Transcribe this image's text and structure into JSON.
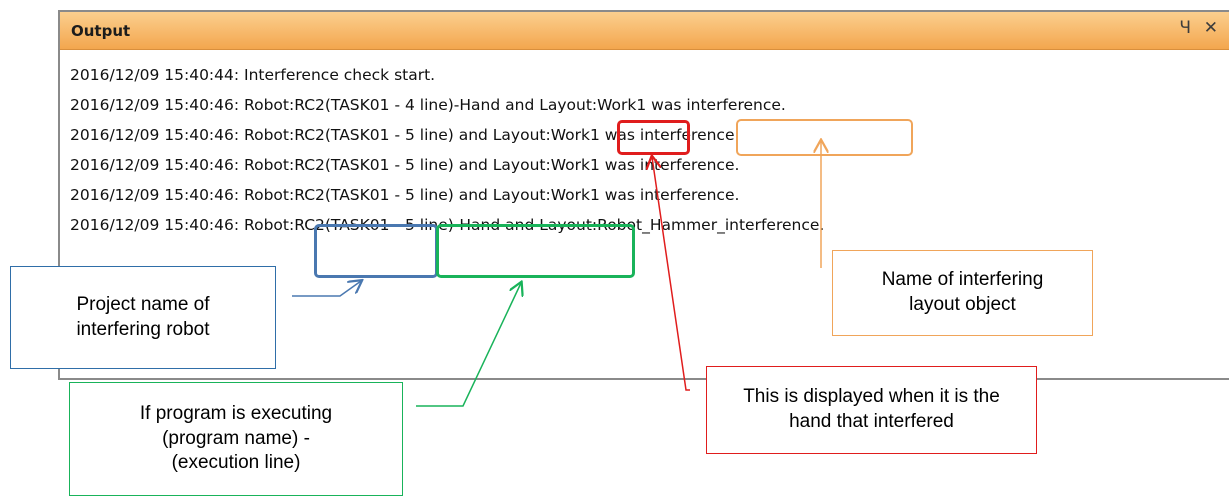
{
  "window": {
    "title": "Output",
    "pin_icon": "pin-icon",
    "close_icon": "close-icon",
    "pin_glyph": "Ч",
    "close_glyph": "✕"
  },
  "log_lines": [
    "2016/12/09 15:40:44: Interference check start.",
    "2016/12/09 15:40:46: Robot:RC2(TASK01 - 4 line)-Hand and Layout:Work1 was interference.",
    "2016/12/09 15:40:46: Robot:RC2(TASK01 - 5 line) and Layout:Work1 was interference.",
    "2016/12/09 15:40:46: Robot:RC2(TASK01 - 5 line) and Layout:Work1 was interference.",
    "2016/12/09 15:40:46: Robot:RC2(TASK01 - 5 line) and Layout:Work1 was interference.",
    "2016/12/09 15:40:46: Robot:RC2(TASK01 - 5 line)-Hand and Layout:Robot_Hammer_interference."
  ],
  "callouts": {
    "project_name": "Project name of interfering robot",
    "program": "If program is executing (program name) - (execution line)",
    "hand": "This is displayed when it is the hand that interfered",
    "layout": "Name of interfering layout object"
  },
  "colors": {
    "title_bar": "#f5ac55",
    "blue": "#4a78b0",
    "green": "#19b35a",
    "red": "#e01d1d",
    "orange": "#f0a55a"
  }
}
